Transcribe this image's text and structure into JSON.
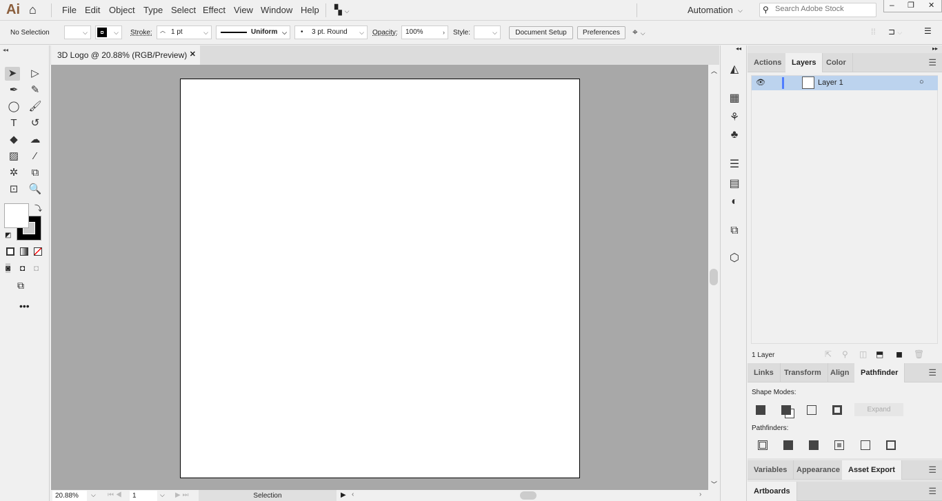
{
  "app": {
    "logo": "Ai",
    "workspace": "Automation",
    "search_placeholder": "Search Adobe Stock"
  },
  "menu": [
    "File",
    "Edit",
    "Object",
    "Type",
    "Select",
    "Effect",
    "View",
    "Window",
    "Help"
  ],
  "control": {
    "selection": "No Selection",
    "stroke_label": "Stroke:",
    "stroke_value": "1 pt",
    "profile": "Uniform",
    "brush": "3 pt. Round",
    "opacity_label": "Opacity:",
    "opacity_value": "100%",
    "style_label": "Style:",
    "document_setup": "Document Setup",
    "preferences": "Preferences"
  },
  "document": {
    "tab_title": "3D Logo @ 20.88% (RGB/Preview)"
  },
  "status": {
    "zoom": "20.88%",
    "artboard": "1",
    "tool": "Selection"
  },
  "layers_panel": {
    "tabs": [
      "Actions",
      "Layers",
      "Color"
    ],
    "active": "Layers",
    "layers": [
      {
        "name": "Layer 1",
        "visible": true
      }
    ],
    "count": "1 Layer"
  },
  "pathfinder_panel": {
    "tabs": [
      "Links",
      "Transform",
      "Align",
      "Pathfinder"
    ],
    "active": "Pathfinder",
    "shape_modes": "Shape Modes:",
    "expand": "Expand",
    "pathfinders": "Pathfinders:"
  },
  "export_panel": {
    "tabs": [
      "Variables",
      "Appearance",
      "Asset Export"
    ],
    "active": "Asset Export"
  },
  "artboards_panel": {
    "tabs": [
      "Artboards"
    ]
  },
  "colors": {
    "logo": "#8b5e3c",
    "canvas": "#a8a8a8",
    "layer_highlight": "#bcd3ee",
    "layer_color": "#4f7dff"
  }
}
